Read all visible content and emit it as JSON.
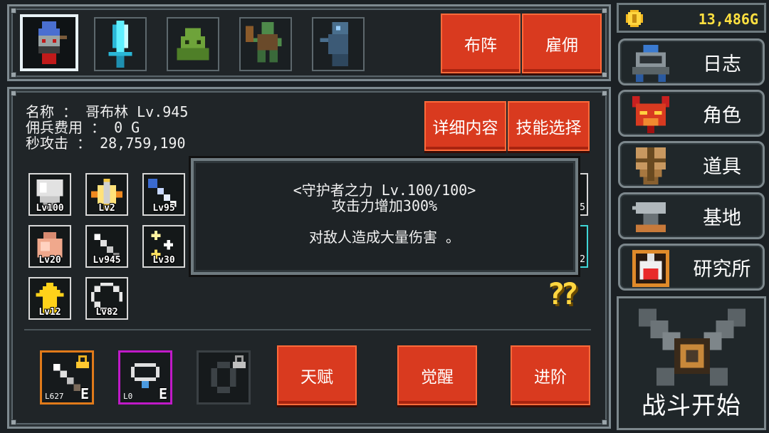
{
  "currency": {
    "amount": "13,486G",
    "icon": "gold-coin-icon"
  },
  "top": {
    "portraits": [
      {
        "name": "goblin-portrait",
        "selected": true
      },
      {
        "name": "crystal-sword-portrait",
        "selected": false
      },
      {
        "name": "green-slime-portrait",
        "selected": false
      },
      {
        "name": "orc-club-portrait",
        "selected": false
      },
      {
        "name": "ghost-portrait",
        "selected": false
      }
    ],
    "formation_label": "布阵",
    "hire_label": "雇佣"
  },
  "unit": {
    "name_line": "名称 ： 哥布林 Lv.945",
    "cost_line": "佣兵费用 ： 0 G",
    "dps_line": "秒攻击 ： 28,759,190",
    "details_label": "详细内容",
    "skill_select_label": "技能选择"
  },
  "skills": [
    {
      "icon": "shield-icon",
      "level": "Lv100"
    },
    {
      "icon": "sword-burst-icon",
      "level": "Lv2"
    },
    {
      "icon": "blue-sword-icon",
      "level": "Lv95"
    },
    {
      "icon": "money-bag-icon",
      "level": "Lv20"
    },
    {
      "icon": "sword-icon",
      "level": "Lv945"
    },
    {
      "icon": "sparkle-icon",
      "level": "Lv30"
    },
    {
      "icon": "arrow-up-icon",
      "level": "Lv12"
    },
    {
      "icon": "ring-icon",
      "level": "Lv82"
    }
  ],
  "skill_edge_right": {
    "top_digit": "5",
    "bottom_digit": "2"
  },
  "tooltip": {
    "title": "<守护者之力 Lv.100/100>",
    "effect": "攻击力增加300%",
    "description": "对敌人造成大量伤害 。"
  },
  "help_mark": "??",
  "equipment": [
    {
      "icon": "sword-equip-icon",
      "level": "L627",
      "tag": "E",
      "frame_color": "#e07a1a",
      "locked": true
    },
    {
      "icon": "necklace-equip-icon",
      "level": "L0",
      "tag": "E",
      "frame_color": "#c01ac8",
      "locked": true
    },
    {
      "icon": "ring-equip-icon",
      "level": "",
      "tag": "",
      "frame_color": "#3a4044",
      "locked": true
    }
  ],
  "actions": {
    "talent_label": "天赋",
    "awaken_label": "觉醒",
    "advance_label": "进阶"
  },
  "sidebar": [
    {
      "icon": "cart-icon",
      "label": "日志"
    },
    {
      "icon": "demon-mask-icon",
      "label": "角色"
    },
    {
      "icon": "shield-item-icon",
      "label": "道具"
    },
    {
      "icon": "anvil-icon",
      "label": "基地"
    },
    {
      "icon": "potion-icon",
      "label": "研究所"
    }
  ],
  "battle": {
    "label": "战斗开始",
    "icon": "crossed-swords-icon"
  },
  "colors": {
    "accent_red": "#d93a1f",
    "gold": "#ffd640",
    "frame": "#7e8a90"
  }
}
